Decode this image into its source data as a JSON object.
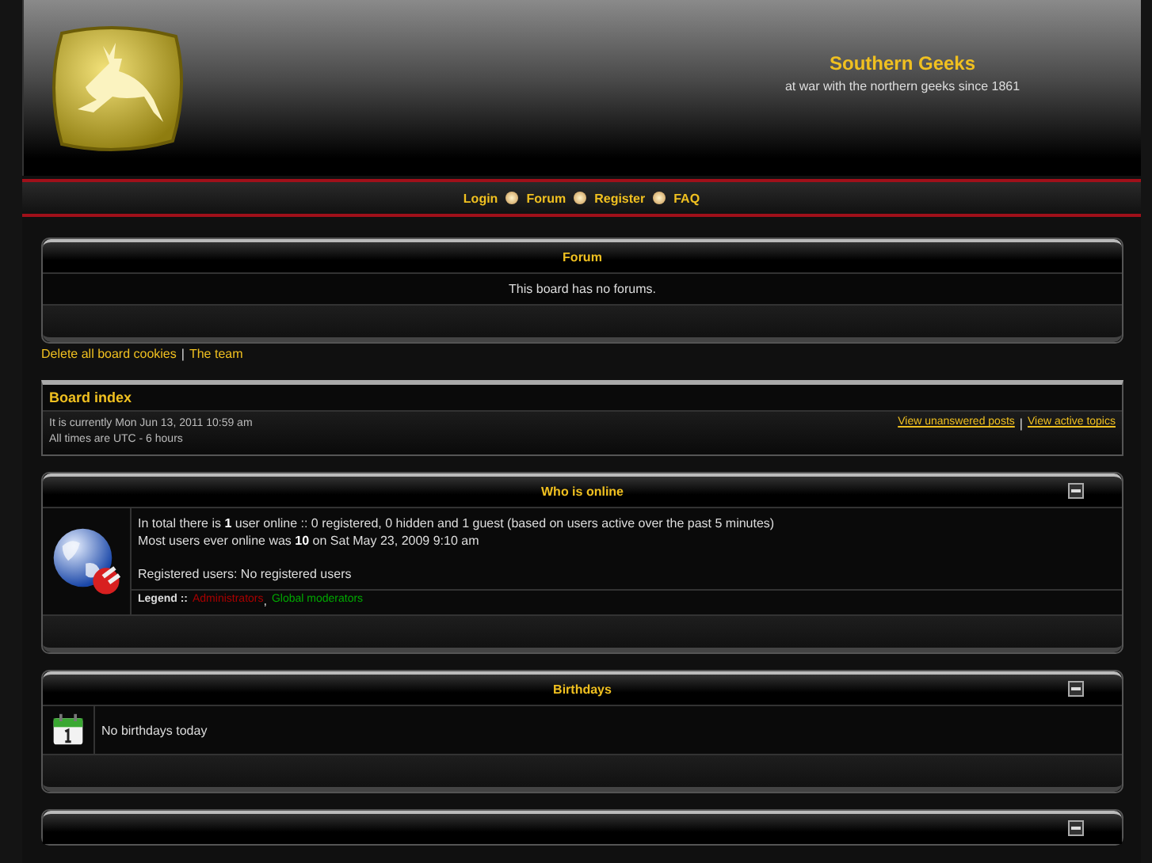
{
  "header": {
    "title": "Southern Geeks",
    "tagline": "at war with the northern geeks since 1861"
  },
  "nav": [
    "Login",
    "Forum",
    "Register",
    "FAQ"
  ],
  "forum_panel": {
    "title": "Forum",
    "message": "This board has no forums."
  },
  "footer_links": [
    "Delete all board cookies",
    "The team"
  ],
  "footer_separator": "|",
  "board_index": {
    "title": "Board index",
    "current_time": "It is currently Mon Jun 13, 2011 10:59 am",
    "timezone": "All times are UTC - 6 hours",
    "links": [
      "View unanswered posts",
      "View active topics"
    ],
    "separator": "|"
  },
  "who_is_online": {
    "title": "Who is online",
    "expanded": true,
    "lines": [
      "In total there is **1** user online :: 0 registered, 0 hidden and 1 guest (based on users active over the past 5 minutes)",
      "Most users ever online was **10** on Sat May 23, 2009 9:10 am"
    ],
    "registered": "Registered users: No registered users",
    "legend_label": "Legend ::",
    "group_separator": ",",
    "groups": [
      {
        "name": "Administrators",
        "color": "#aa0000"
      },
      {
        "name": "Global moderators",
        "color": "#00aa00"
      }
    ]
  },
  "birthdays": {
    "title": "Birthdays",
    "expanded": true,
    "message": "No birthdays today"
  },
  "statistics": {
    "expanded": true
  }
}
